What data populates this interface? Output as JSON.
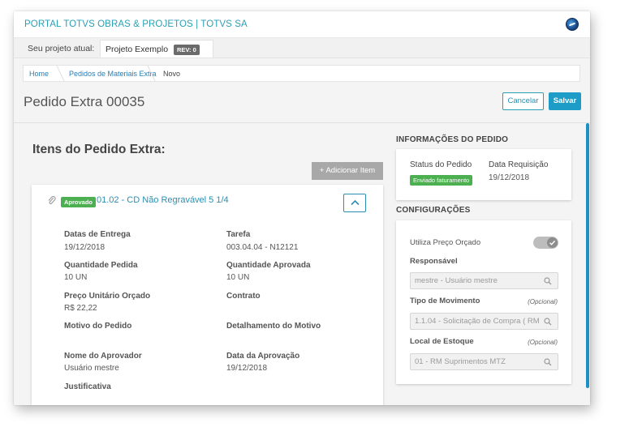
{
  "header": {
    "portal_title": "PORTAL TOTVS OBRAS & PROJETOS | TOTVS SA",
    "globe_icon": "globe-icon"
  },
  "project": {
    "label": "Seu projeto atual:",
    "name": "Projeto Exemplo",
    "rev": "REV: 0"
  },
  "breadcrumb": {
    "home": "Home",
    "section": "Pedidos de Materiais Extra",
    "current": "Novo"
  },
  "page": {
    "title": "Pedido Extra 00035",
    "cancel_label": "Cancelar",
    "save_label": "Salvar"
  },
  "items": {
    "title": "Itens do Pedido Extra:",
    "add_label": "+ Adicionar Item",
    "item": {
      "status": "Aprovado",
      "name": "01.02 - CD Não Regravável 5 1/4",
      "fields": {
        "entrega_label": "Datas de Entrega",
        "entrega_value": "19/12/2018",
        "tarefa_label": "Tarefa",
        "tarefa_value": "003.04.04 - N12121",
        "qtd_pedida_label": "Quantidade Pedida",
        "qtd_pedida_value": "10 UN",
        "qtd_aprovada_label": "Quantidade Aprovada",
        "qtd_aprovada_value": "10 UN",
        "preco_label": "Preço Unitário Orçado",
        "preco_value": "R$ 22,22",
        "contrato_label": "Contrato",
        "motivo_label": "Motivo do Pedido",
        "detalhamento_label": "Detalhamento do Motivo",
        "aprovador_label": "Nome do Aprovador",
        "aprovador_value": "Usuário mestre",
        "data_aprov_label": "Data da Aprovação",
        "data_aprov_value": "19/12/2018",
        "justificativa_label": "Justificativa"
      }
    }
  },
  "info": {
    "title": "INFORMAÇÕES DO PEDIDO",
    "status_label": "Status do Pedido",
    "status_value": "Enviado faturamento",
    "data_label": "Data Requisição",
    "data_value": "19/12/2018"
  },
  "config": {
    "title": "CONFIGURAÇÕES",
    "preco_orcado_label": "Utiliza Preço Orçado",
    "responsavel_label": "Responsável",
    "responsavel_placeholder": "mestre - Usuário mestre",
    "tipo_label": "Tipo de Movimento",
    "tipo_optional": "(Opcional)",
    "tipo_placeholder": "1.1.04 - Solicitação de Compra  ( RM",
    "local_label": "Local de Estoque",
    "local_optional": "(Opcional)",
    "local_placeholder": "01 - RM Suprimentos MTZ"
  },
  "colors": {
    "accent": "#1e9cc8",
    "link": "#2a8fb3",
    "success": "#4caf50"
  }
}
